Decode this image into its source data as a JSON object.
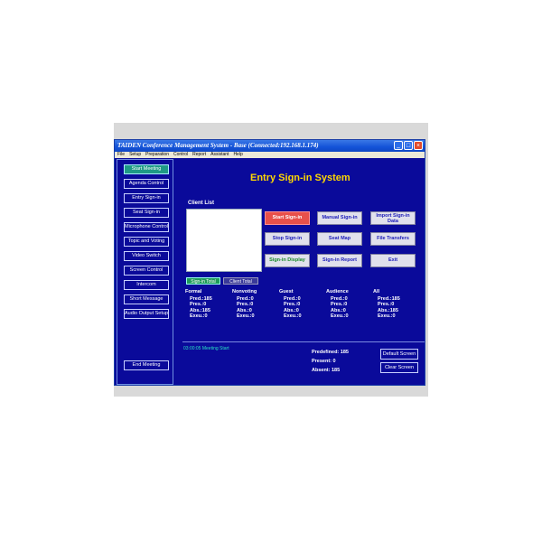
{
  "window": {
    "title": "TAIDEN Conference Management System - Base (Connected:192.168.1.174)",
    "menu": [
      "File",
      "Setup",
      "Preparation",
      "Control",
      "Report",
      "Assistant",
      "Help"
    ]
  },
  "sidebar": {
    "items": [
      {
        "label": "Start Meeting",
        "active": true
      },
      {
        "label": "Agenda Control"
      },
      {
        "label": "Entry Sign-in"
      },
      {
        "label": "Seat Sign-in"
      },
      {
        "label": "Microphone Control"
      },
      {
        "label": "Topic and Voting"
      },
      {
        "label": "Video Switch"
      },
      {
        "label": "Screen Control"
      },
      {
        "label": "Intercom"
      },
      {
        "label": "Short Message"
      },
      {
        "label": "Audio Output Setup"
      }
    ],
    "end_meeting": "End Meeting"
  },
  "main": {
    "title": "Entry Sign-in System",
    "client_list_label": "Client List",
    "buttons": [
      {
        "label": "Start Sign-in"
      },
      {
        "label": "Manual Sign-in"
      },
      {
        "label": "Import Sign-in Data"
      },
      {
        "label": "Stop Sign-in"
      },
      {
        "label": "Seat Map"
      },
      {
        "label": "File Transfers"
      },
      {
        "label": "Sign-in Display"
      },
      {
        "label": "Sign-in Report"
      },
      {
        "label": "Exit"
      }
    ],
    "tabs": [
      "Sign-in Total",
      "Client Total"
    ],
    "stats": [
      {
        "header": "Formal",
        "pred": "Pred.:185",
        "pres": "Pres.:0",
        "abs": "Abs.:185",
        "exeu": "Exeu.:0"
      },
      {
        "header": "Nonvoting",
        "pred": "Pred.:0",
        "pres": "Pres.:0",
        "abs": "Abs.:0",
        "exeu": "Exeu.:0"
      },
      {
        "header": "Guest",
        "pred": "Pred.:0",
        "pres": "Pres.:0",
        "abs": "Abs.:0",
        "exeu": "Exeu.:0"
      },
      {
        "header": "Audience",
        "pred": "Pred.:0",
        "pres": "Pres.:0",
        "abs": "Abs.:0",
        "exeu": "Exeu.:0"
      },
      {
        "header": "All",
        "pred": "Pred.:185",
        "pres": "Pres.:0",
        "abs": "Abs.:185",
        "exeu": "Exeu.:0"
      }
    ]
  },
  "footer": {
    "log": "03:00:05 Meeting Start",
    "predefined": "Predefined: 185",
    "present": "Present: 0",
    "absent": "Absent: 185",
    "default_screen": "Default Screen",
    "clear_screen": "Clear Screen"
  },
  "colors": {
    "background": "#0a0a9a",
    "title": "#ffd800",
    "accent_red": "#e8504a",
    "active_green": "#1f9a86"
  }
}
